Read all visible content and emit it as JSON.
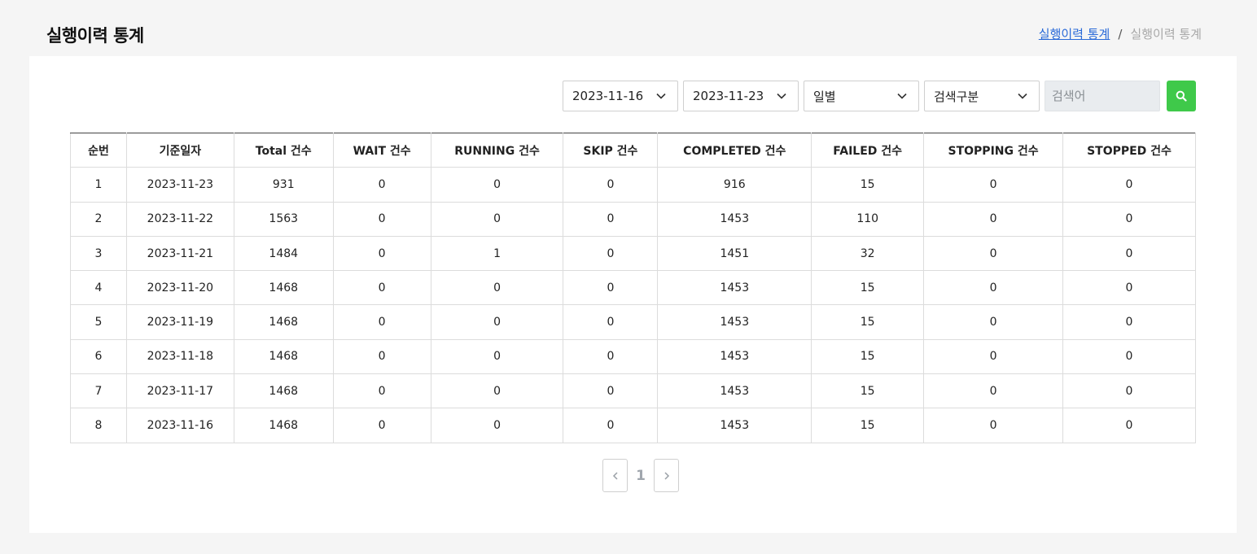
{
  "header": {
    "title": "실행이력 통계",
    "breadcrumb_link": "실행이력 통계",
    "breadcrumb_separator": "/",
    "breadcrumb_current": "실행이력 통계"
  },
  "filters": {
    "start_date": "2023-11-16",
    "end_date": "2023-11-23",
    "period": "일별",
    "search_type": "검색구분",
    "search_placeholder": "검색어",
    "search_value": ""
  },
  "table": {
    "columns": [
      "순번",
      "기준일자",
      "Total 건수",
      "WAIT 건수",
      "RUNNING 건수",
      "SKIP 건수",
      "COMPLETED 건수",
      "FAILED 건수",
      "STOPPING 건수",
      "STOPPED 건수"
    ],
    "rows": [
      [
        "1",
        "2023-11-23",
        "931",
        "0",
        "0",
        "0",
        "916",
        "15",
        "0",
        "0"
      ],
      [
        "2",
        "2023-11-22",
        "1563",
        "0",
        "0",
        "0",
        "1453",
        "110",
        "0",
        "0"
      ],
      [
        "3",
        "2023-11-21",
        "1484",
        "0",
        "1",
        "0",
        "1451",
        "32",
        "0",
        "0"
      ],
      [
        "4",
        "2023-11-20",
        "1468",
        "0",
        "0",
        "0",
        "1453",
        "15",
        "0",
        "0"
      ],
      [
        "5",
        "2023-11-19",
        "1468",
        "0",
        "0",
        "0",
        "1453",
        "15",
        "0",
        "0"
      ],
      [
        "6",
        "2023-11-18",
        "1468",
        "0",
        "0",
        "0",
        "1453",
        "15",
        "0",
        "0"
      ],
      [
        "7",
        "2023-11-17",
        "1468",
        "0",
        "0",
        "0",
        "1453",
        "15",
        "0",
        "0"
      ],
      [
        "8",
        "2023-11-16",
        "1468",
        "0",
        "0",
        "0",
        "1453",
        "15",
        "0",
        "0"
      ]
    ]
  },
  "pagination": {
    "current_page": "1",
    "prev_icon": "chevron-left-icon",
    "next_icon": "chevron-right-icon"
  },
  "colors": {
    "search_button": "#3fc94a",
    "breadcrumb_link": "#2a6ad8",
    "page_background": "#f5f5f5"
  }
}
